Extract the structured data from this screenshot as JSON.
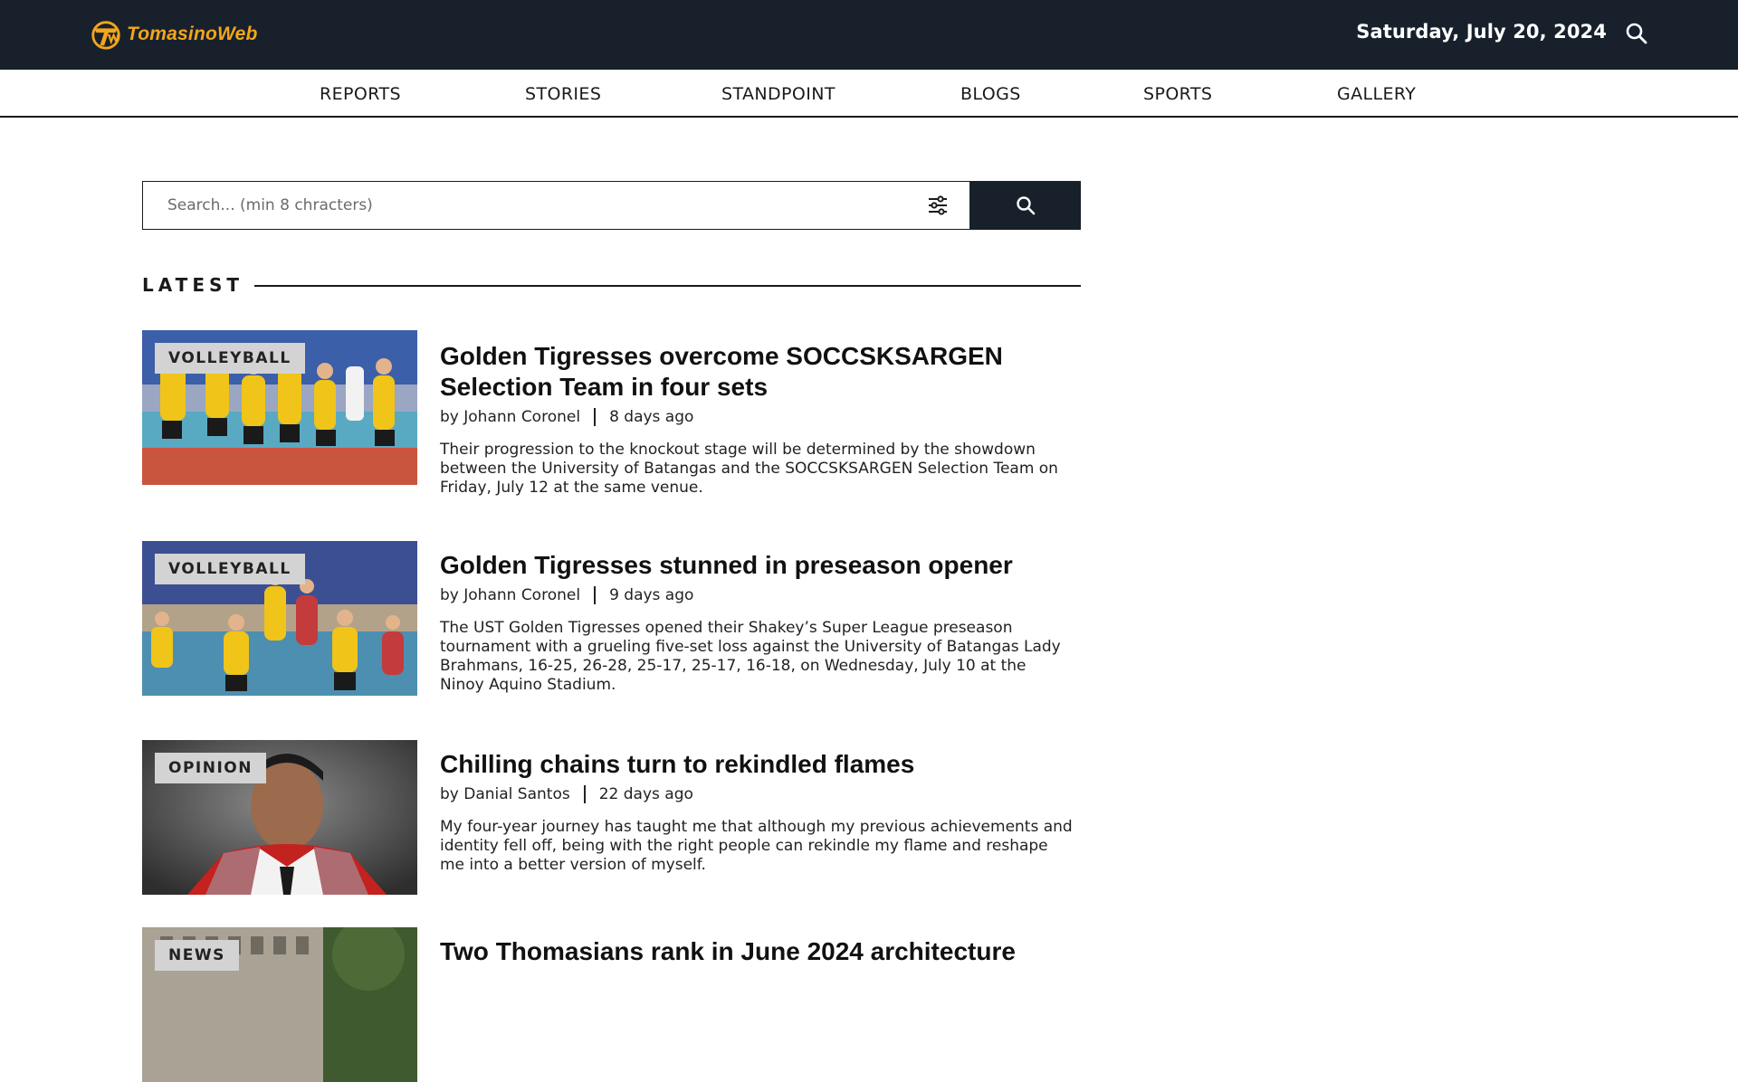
{
  "header": {
    "logo_text": "TomasinoWeb",
    "date": "Saturday, July 20, 2024",
    "search_icon": "search-icon"
  },
  "nav": {
    "items": [
      {
        "label": "REPORTS"
      },
      {
        "label": "STORIES"
      },
      {
        "label": "STANDPOINT"
      },
      {
        "label": "BLOGS"
      },
      {
        "label": "SPORTS"
      },
      {
        "label": "GALLERY"
      }
    ]
  },
  "search": {
    "placeholder": "Search... (min 8 chracters)",
    "value": "",
    "filter_icon": "sliders-icon",
    "button_icon": "search-icon"
  },
  "latest": {
    "heading": "LATEST",
    "articles": [
      {
        "category": "VOLLEYBALL",
        "title": "Golden Tigresses overcome SOCCSKSARGEN Selection Team in four sets",
        "author": "by Johann Coronel",
        "time": "8 days ago",
        "excerpt": "Their progression to the knockout stage will be determined by the showdown between the University of Batangas and the SOCCSKSARGEN Selection Team on Friday, July 12 at the same venue."
      },
      {
        "category": "VOLLEYBALL",
        "title": "Golden Tigresses stunned in preseason opener",
        "author": "by Johann Coronel",
        "time": "9 days ago",
        "excerpt": "The UST Golden Tigresses opened their Shakey’s Super League preseason tournament with a grueling five-set loss against the University of Batangas Lady Brahmans, 16-25, 26-28, 25-17, 25-17, 16-18, on Wednesday, July 10 at the Ninoy Aquino Stadium."
      },
      {
        "category": "OPINION",
        "title": "Chilling chains turn to rekindled flames",
        "author": "by Danial Santos",
        "time": "22 days ago",
        "excerpt": "My four-year journey has taught me that although my previous achievements and identity fell off, being with the right people can rekindle my flame and reshape me into a better version of myself."
      },
      {
        "category": "NEWS",
        "title": "Two Thomasians rank in June 2024 architecture",
        "author": "",
        "time": "",
        "excerpt": ""
      }
    ]
  },
  "colors": {
    "topbar_bg": "#18212b",
    "logo_accent": "#f3a51b",
    "category_badge_bg": "#d3d3d3"
  }
}
